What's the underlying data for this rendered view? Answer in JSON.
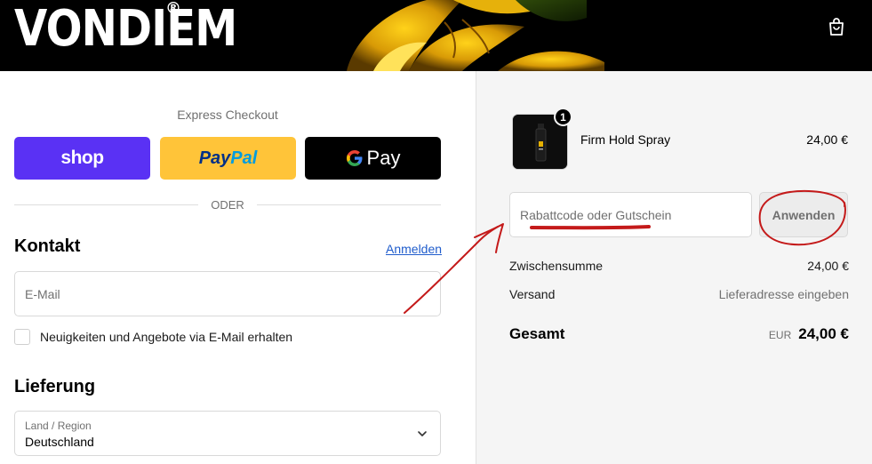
{
  "header": {
    "brand": "VONDIEM",
    "brand_mark": "®",
    "cart_icon": "shopping-bag-icon"
  },
  "express": {
    "title": "Express Checkout",
    "shop_label": "shop",
    "paypal_label_1": "Pay",
    "paypal_label_2": "Pal",
    "gpay_g": "G",
    "gpay_label": "Pay",
    "divider": "ODER"
  },
  "contact": {
    "heading": "Kontakt",
    "login_link": "Anmelden",
    "email_placeholder": "E-Mail",
    "email_value": "",
    "newsletter_label": "Neuigkeiten und Angebote via E-Mail erhalten",
    "newsletter_checked": false
  },
  "delivery": {
    "heading": "Lieferung",
    "country_label": "Land / Region",
    "country_value": "Deutschland"
  },
  "summary": {
    "product": {
      "name": "Firm Hold Spray",
      "price": "24,00 €",
      "quantity": "1"
    },
    "discount_placeholder": "Rabattcode oder Gutschein",
    "apply_label": "Anwenden",
    "subtotal_label": "Zwischensumme",
    "subtotal_value": "24,00 €",
    "shipping_label": "Versand",
    "shipping_value": "Lieferadresse eingeben",
    "total_label": "Gesamt",
    "total_currency": "EUR",
    "total_value": "24,00 €"
  },
  "colors": {
    "shop_pay": "#5a31f4",
    "paypal": "#ffc439",
    "link": "#1f5ccc",
    "annotation": "#c41a1a"
  }
}
